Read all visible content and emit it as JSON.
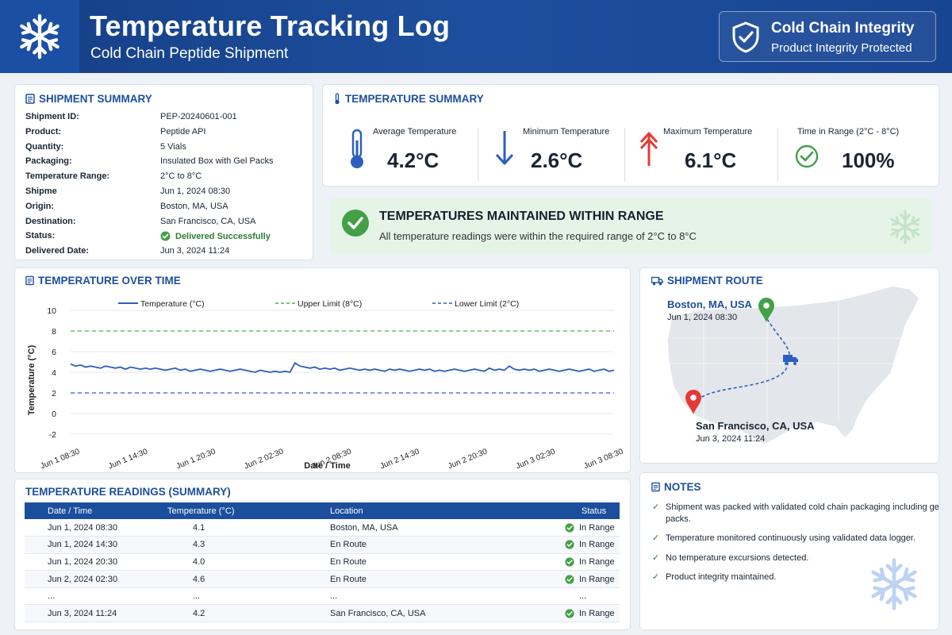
{
  "header": {
    "title": "Temperature Tracking Log",
    "subtitle": "Cold Chain Peptide Shipment",
    "badge_title": "Cold Chain Integrity",
    "badge_sub": "Product Integrity Protected"
  },
  "shipment": {
    "title": "SHIPMENT SUMMARY",
    "rows": [
      {
        "k": "Shipment ID:",
        "v": "PEP-20240601-001"
      },
      {
        "k": "Product:",
        "v": "Peptide API"
      },
      {
        "k": "Quantity:",
        "v": "5 Vials"
      },
      {
        "k": "Packaging:",
        "v": "Insulated Box with Gel Packs"
      },
      {
        "k": "Temperature Range:",
        "v": "2°C to 8°C"
      },
      {
        "k": "Shipme",
        "v": "Jun 1, 2024 08:30"
      },
      {
        "k": "Origin:",
        "v": "Boston, MA, USA"
      },
      {
        "k": "Destination:",
        "v": "San Francisco, CA, USA"
      },
      {
        "k": "Status:",
        "v": "Delivered Successfully"
      },
      {
        "k": "Delivered Date:",
        "v": "Jun 3, 2024 11:24"
      }
    ]
  },
  "temp_summary": {
    "title": "TEMPERATURE SUMMARY",
    "avg_label": "Average Temperature",
    "avg_value": "4.2°C",
    "min_label": "Minimum Temperature",
    "min_value": "2.6°C",
    "max_label": "Maximum Temperature",
    "max_value": "6.1°C",
    "range_label": "Time  in Range (2°C - 8°C)",
    "range_value": "100%"
  },
  "alert": {
    "title": "TEMPERATURES MAINTAINED WITHIN RANGE",
    "sub": "All temperature readings were within the required range of 2°C to 8°C"
  },
  "chart_title": "TEMPERATURE OVER TIME",
  "chart_data": {
    "type": "line",
    "xlabel": "Date / Time",
    "ylabel": "Temperature (°C)",
    "ylim": [
      -2,
      10
    ],
    "yticks": [
      -2,
      0,
      2,
      4,
      6,
      8,
      10
    ],
    "xticks": [
      "Jun 1 08:30",
      "Jun 1 14:30",
      "Jun 1 20:30",
      "Jun 2 02:30",
      "Jun 2 08:30",
      "Jun 2 14:30",
      "Jun 2 20:30",
      "Jun 3 02:30",
      "Jun 3 08:30"
    ],
    "legend_position": "top",
    "grid": "horizontal",
    "series": [
      {
        "name": "Temperature (°C)",
        "color": "#2b5fbf",
        "style": "solid",
        "values": [
          4.8,
          4.6,
          4.7,
          4.5,
          4.6,
          4.5,
          4.4,
          4.6,
          4.5,
          4.4,
          4.5,
          4.3,
          4.5,
          4.4,
          4.3,
          4.4,
          4.3,
          4.4,
          4.3,
          4.2,
          4.3,
          4.4,
          4.2,
          4.3,
          4.1,
          4.2,
          4.3,
          4.2,
          4.1,
          4.2,
          4.3,
          4.2,
          4.1,
          4.2,
          4.3,
          4.2,
          4.1,
          4.0,
          4.2,
          4.1,
          4.0,
          4.1,
          4.0,
          4.1,
          4.0,
          4.9,
          4.6,
          4.5,
          4.4,
          4.5,
          4.3,
          4.4,
          4.3,
          4.4,
          4.2,
          4.3,
          4.4,
          4.3,
          4.2,
          4.3,
          4.2,
          4.3,
          4.2,
          4.1,
          4.3,
          4.2,
          4.3,
          4.2,
          4.1,
          4.2,
          4.3,
          4.2,
          4.3,
          4.1,
          4.2,
          4.1,
          4.2,
          4.3,
          4.2,
          4.1,
          4.2,
          4.3,
          4.2,
          4.1,
          4.4,
          4.2,
          4.3,
          4.2,
          4.6,
          4.3,
          4.2,
          4.3,
          4.2,
          4.3,
          4.1,
          4.2,
          4.3,
          4.2,
          4.1,
          4.2,
          4.3,
          4.2,
          4.1,
          4.2,
          4.3,
          4.1,
          4.2,
          4.3,
          4.1,
          4.2
        ]
      },
      {
        "name": "Upper Limit (8°C)",
        "color": "#4caf50",
        "style": "dashed",
        "values": [
          8,
          8
        ]
      },
      {
        "name": "Lower Limit (2°C)",
        "color": "#2b5fbf",
        "style": "dashed",
        "values": [
          2,
          2
        ]
      }
    ]
  },
  "route": {
    "title": "SHIPMENT ROUTE",
    "origin": "Boston, MA, USA",
    "origin_date": "Jun 1, 2024 08:30",
    "destination": "San Francisco, CA, USA",
    "destination_date": "Jun 3, 2024 11:24"
  },
  "readings": {
    "title": "TEMPERATURE READINGS (SUMMARY)",
    "headers": [
      "Date / Time",
      "Temperature (°C)",
      "Location",
      "Status"
    ],
    "rows": [
      {
        "date": "Jun 1, 2024 08:30",
        "temp": "4.1",
        "loc": "Boston, MA, USA",
        "status": "In Range",
        "check": true
      },
      {
        "date": "Jun 1, 2024 14:30",
        "temp": "4.3",
        "loc": "En Route",
        "status": "In Range",
        "check": true
      },
      {
        "date": "Jun 1, 2024 20:30",
        "temp": "4.0",
        "loc": "En Route",
        "status": "In Range",
        "check": true
      },
      {
        "date": "Jun 2, 2024 02:30",
        "temp": "4.6",
        "loc": "En Route",
        "status": "In Range",
        "check": true
      },
      {
        "date": "...",
        "temp": "...",
        "loc": "...",
        "status": "...",
        "check": false
      },
      {
        "date": "Jun 3, 2024 11:24",
        "temp": "4.2",
        "loc": "San Francisco, CA, USA",
        "status": "In Range",
        "check": true
      }
    ]
  },
  "notes": {
    "title": "NOTES",
    "items": [
      "Shipment was packed with validated cold chain packaging including gel packs.",
      "Temperature monitored continuously using validated data logger.",
      "No temperature excursions detected.",
      "Product integrity maintained."
    ]
  },
  "colors": {
    "brand": "#1d4f9e",
    "success": "#43a047",
    "danger": "#e53935"
  }
}
